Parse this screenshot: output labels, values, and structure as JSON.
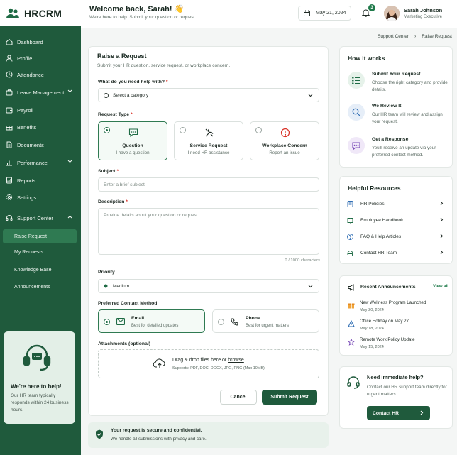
{
  "brand": {
    "name": "HRCRM"
  },
  "header": {
    "welcome": "Welcome back, Sarah! 👋",
    "subtitle": "We're here to help. Submit your question or request.",
    "date": "May 21, 2024",
    "notification_count": "3",
    "user_name": "Sarah Johnson",
    "user_role": "Marketing Executive"
  },
  "sidebar": {
    "items": [
      {
        "label": "Dashboard",
        "icon": "grid-icon"
      },
      {
        "label": "Profile",
        "icon": "user-icon"
      },
      {
        "label": "Attendance",
        "icon": "clock-icon"
      },
      {
        "label": "Leave Management",
        "icon": "briefcase-icon"
      },
      {
        "label": "Payroll",
        "icon": "wallet-icon"
      },
      {
        "label": "Benefits",
        "icon": "gift-icon"
      },
      {
        "label": "Documents",
        "icon": "document-icon"
      },
      {
        "label": "Performance",
        "icon": "chart-icon"
      },
      {
        "label": "Reports",
        "icon": "reports-icon"
      },
      {
        "label": "Settings",
        "icon": "gear-icon"
      },
      {
        "label": "Support Center",
        "icon": "headset-icon"
      }
    ],
    "sub_items": [
      "Raise Request",
      "My Requests",
      "Knowledge Base",
      "Announcements"
    ],
    "help_title": "We're here to help!",
    "help_text": "Our HR team typically responds within 24 business hours."
  },
  "breadcrumb": {
    "parent": "Support Center",
    "separator": "›",
    "current": "Raise Request"
  },
  "form": {
    "title": "Raise a Request",
    "subtitle": "Submit your HR question, service request, or workplace concern.",
    "category_label": "What do you need help with?",
    "category_placeholder": "Select a category",
    "type_label": "Request Type",
    "types": [
      {
        "name": "Question",
        "desc": "I have a question",
        "icon": "chat-question-icon"
      },
      {
        "name": "Service Request",
        "desc": "I need HR assistance",
        "icon": "tools-icon"
      },
      {
        "name": "Workplace Concern",
        "desc": "Report an issue",
        "icon": "alert-icon"
      }
    ],
    "subject_label": "Subject",
    "subject_placeholder": "Enter a brief subject",
    "description_label": "Description",
    "description_placeholder": "Provide details about your question or request...",
    "char_counter": "0 / 1000 characters",
    "priority_label": "Priority",
    "priority_value": "Medium",
    "contact_label": "Preferred Contact Method",
    "contacts": [
      {
        "name": "Email",
        "desc": "Best for detailed updates",
        "icon": "mail-icon"
      },
      {
        "name": "Phone",
        "desc": "Best for urgent matters",
        "icon": "phone-icon"
      }
    ],
    "attachments_label": "Attachments (optional)",
    "dropzone_text": "Drag & drop files here or",
    "dropzone_link": "browse",
    "dropzone_sub": "Supports: PDF, DOC, DOCX, JPG, PNG (Max 10MB)",
    "cancel_label": "Cancel",
    "submit_label": "Submit Request"
  },
  "secure": {
    "title": "Your request is secure and confidential.",
    "subtitle": "We handle all submissions with privacy and care."
  },
  "how_it_works": {
    "title": "How it works",
    "steps": [
      {
        "title": "Submit Your Request",
        "desc": "Choose the right category and provide details."
      },
      {
        "title": "We Review It",
        "desc": "Our HR team will review and assign your request."
      },
      {
        "title": "Get a Response",
        "desc": "You'll receive an update via your preferred contact method."
      }
    ]
  },
  "resources": {
    "title": "Helpful Resources",
    "items": [
      "HR Policies",
      "Employee Handbook",
      "FAQ & Help Articles",
      "Contact HR Team"
    ]
  },
  "announcements": {
    "title": "Recent Announcements",
    "view_all": "View all",
    "items": [
      {
        "name": "New Wellness Program Launched",
        "date": "May 20, 2024"
      },
      {
        "name": "Office Holiday on May 27",
        "date": "May 18, 2024"
      },
      {
        "name": "Remote Work Policy Update",
        "date": "May 15, 2024"
      }
    ]
  },
  "immediate_help": {
    "title": "Need immediate help?",
    "desc": "Contact our HR support team directly for urgent matters.",
    "button": "Contact HR"
  },
  "colors": {
    "brand_green": "#1f5a3c",
    "active_sub": "#2f7a52",
    "accent": "#1f7a4a",
    "danger": "#d93025"
  }
}
